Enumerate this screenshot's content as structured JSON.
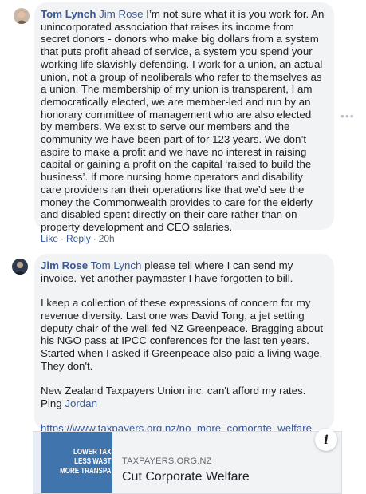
{
  "comments": [
    {
      "author": "Tom Lynch",
      "mention": "Jim Rose",
      "paragraphs": [
        " I’m not sure what it is you work for. An unincorporated association that raises its income from secret donors - donors who make big dollars from a system that puts profit ahead of service, a system you spend your working life slavishly defending. I work for a union, an actual union, not a group of neoliberals who refer to themselves as a union. The membership of my union is transparent, I am democratically elected, we are member-led and run by an honorary committee of management who are also elected by members. We exist to serve our members and the community we have been part of for 123 years. We don’t aspire to make a profit and we have no interest in raising capital or gaining a profit on the capital ‘raised to build the business’. If more nursing home operators and disability care providers ran their operations like that we’d see the money the Commonwealth provides to care for the elderly and disabled spent directly on their care rather than on property development and CEO salaries."
      ],
      "actions": {
        "like": "Like",
        "reply": "Reply",
        "time": "20h"
      },
      "more_icon": "more-options-icon"
    },
    {
      "author": "Jim Rose",
      "mention": "Tom Lynch",
      "first_line": " please tell where I can send my invoice. Yet another paymaster I have forgotten to bill.",
      "paragraph2": "I keep a collection of these expressions of concern for my revenue diversity. Last one was David Tong, a jet setting deputy chair of the well fed NZ Greenpeace. Bragging about his NGO pass at IPCC conferences for the last ten years. Started when I asked if Greenpeace also paid a living wage. They don't.",
      "paragraph3": "New Zealand Taxpayers Union inc. can't afford my rates. Ping ",
      "paragraph3_mention": "Jordan",
      "link": "https://www.taxpayers.org.nz/no_more_corporate_welfare"
    }
  ],
  "link_preview": {
    "image_text": [
      "LOWER TAX",
      "LESS WAST",
      "MORE TRANSPA"
    ],
    "domain": "TAXPAYERS.ORG.NZ",
    "title": "Cut Corporate Welfare",
    "info_icon": "info-icon",
    "info_label": "i"
  }
}
